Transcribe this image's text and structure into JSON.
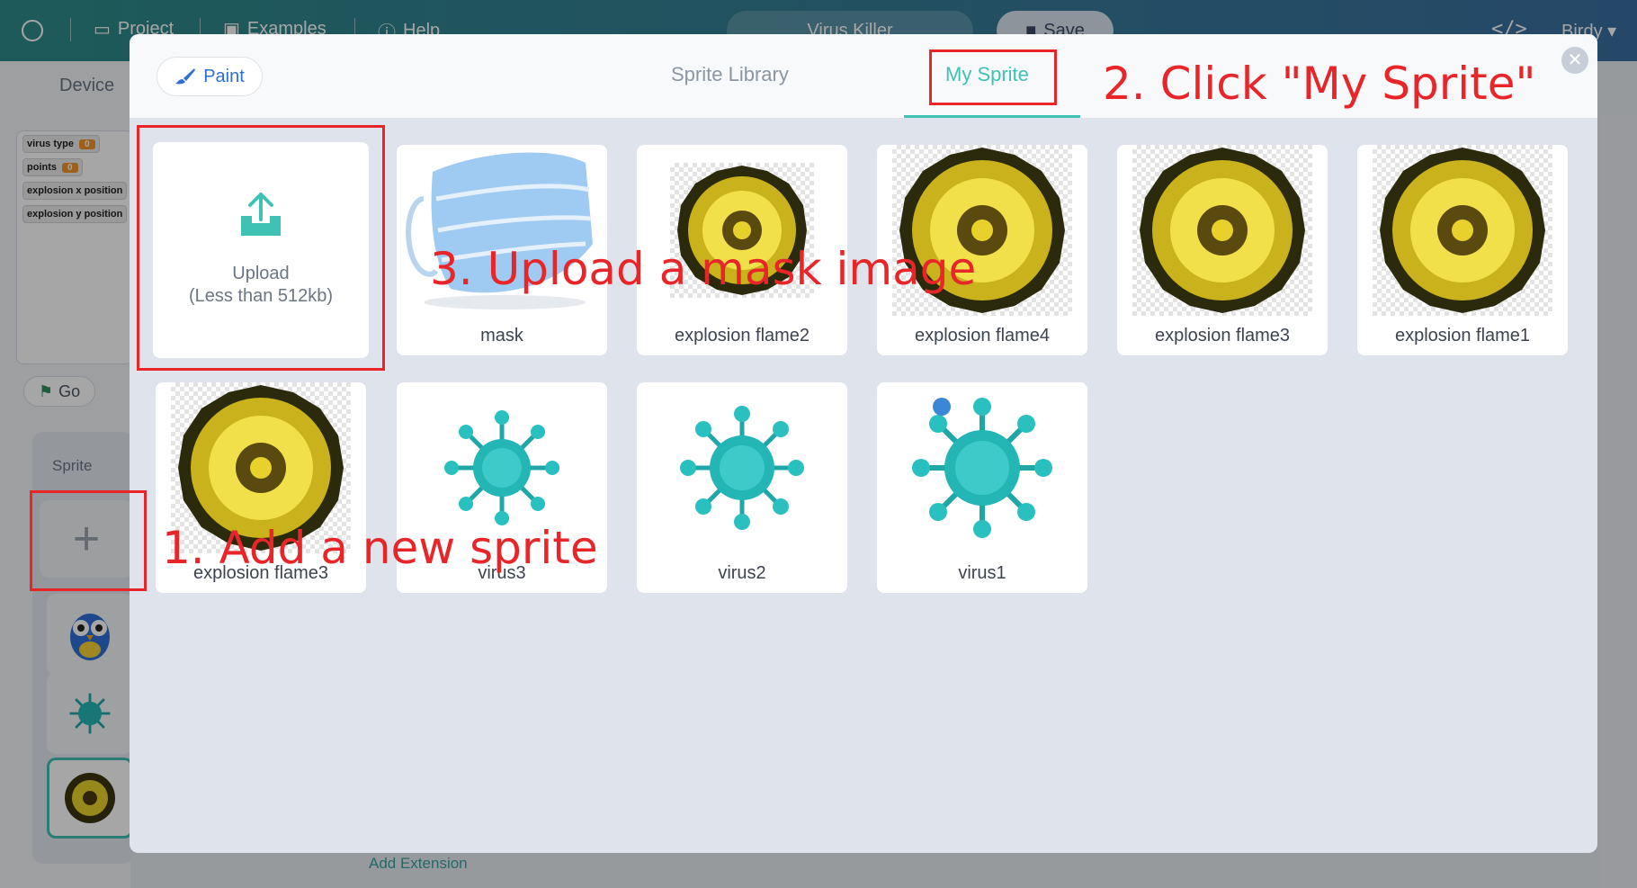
{
  "topbar": {
    "project_label": "Project",
    "examples_label": "Examples",
    "help_label": "Help",
    "project_title": "Virus Killer",
    "save_label": "Save",
    "user_label": "Birdy"
  },
  "left": {
    "device_tab": "Device",
    "variables": [
      {
        "name": "virus type",
        "value": "0"
      },
      {
        "name": "points",
        "value": "0"
      },
      {
        "name": "explosion x position",
        "value": ""
      },
      {
        "name": "explosion y position",
        "value": ""
      }
    ],
    "go_label": "Go",
    "sprite_label": "Sprite",
    "add_extension_label": "Add Extension"
  },
  "modal": {
    "paint_label": "Paint",
    "tabs": [
      "Sprite Library",
      "My Sprite"
    ],
    "active_tab": "My Sprite",
    "upload_label": "Upload",
    "upload_hint": "(Less than 512kb)",
    "sprites_row1": [
      "mask",
      "explosion flame2",
      "explosion flame4",
      "explosion flame3",
      "explosion flame1"
    ],
    "sprites_row2": [
      "explosion flame3",
      "virus3",
      "virus2",
      "virus1"
    ]
  },
  "annotations": {
    "step1": "1. Add a new sprite",
    "step2": "2. Click \"My Sprite\"",
    "step3": "3. Upload a mask image"
  },
  "colors": {
    "accent": "#3fc1b4",
    "annotation": "#e8262a",
    "topbar_start": "#2e8b8a",
    "topbar_end": "#3b6fa0"
  },
  "icons": {
    "paint": "brush-icon",
    "upload": "upload-tray-icon",
    "close": "close-icon",
    "add": "plus-icon"
  }
}
